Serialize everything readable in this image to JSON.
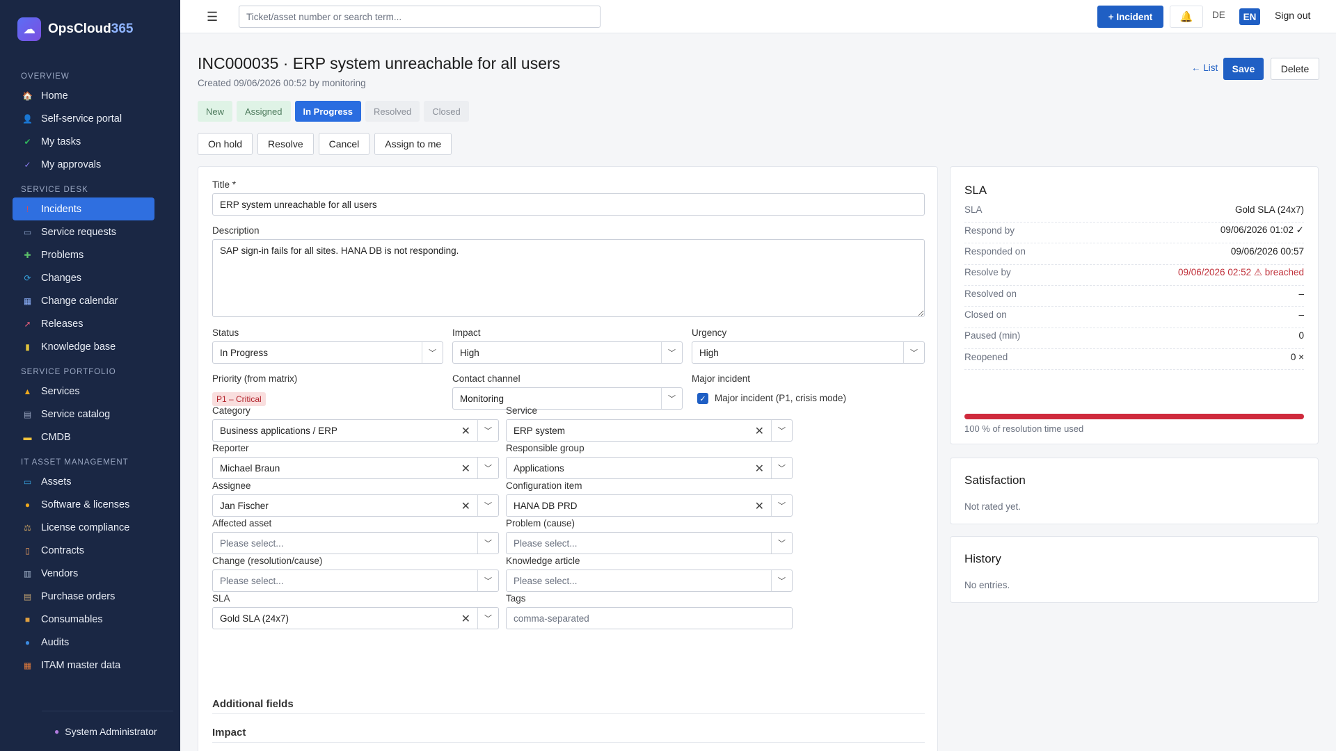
{
  "brand": {
    "name_main": "OpsCloud",
    "name_accent": "365"
  },
  "sidebar": {
    "sections": [
      {
        "title": "OVERVIEW",
        "items": [
          {
            "label": "Home",
            "icon": "home-icon"
          },
          {
            "label": "Self-service portal",
            "icon": "user-icon"
          },
          {
            "label": "My tasks",
            "icon": "check-icon"
          },
          {
            "label": "My approvals",
            "icon": "checkmark-icon"
          }
        ]
      },
      {
        "title": "SERVICE DESK",
        "items": [
          {
            "label": "Incidents",
            "icon": "incident-icon",
            "active": true
          },
          {
            "label": "Service requests",
            "icon": "inbox-icon"
          },
          {
            "label": "Problems",
            "icon": "puzzle-icon"
          },
          {
            "label": "Changes",
            "icon": "refresh-icon"
          },
          {
            "label": "Change calendar",
            "icon": "calendar-icon"
          },
          {
            "label": "Releases",
            "icon": "rocket-icon"
          },
          {
            "label": "Knowledge base",
            "icon": "books-icon"
          }
        ]
      },
      {
        "title": "SERVICE PORTFOLIO",
        "items": [
          {
            "label": "Services",
            "icon": "bell-service-icon"
          },
          {
            "label": "Service catalog",
            "icon": "catalog-icon"
          },
          {
            "label": "CMDB",
            "icon": "folder-icon"
          }
        ]
      },
      {
        "title": "IT ASSET MANAGEMENT",
        "items": [
          {
            "label": "Assets",
            "icon": "monitor-icon"
          },
          {
            "label": "Software & licenses",
            "icon": "disc-icon"
          },
          {
            "label": "License compliance",
            "icon": "scales-icon"
          },
          {
            "label": "Contracts",
            "icon": "document-icon"
          },
          {
            "label": "Vendors",
            "icon": "building-icon"
          },
          {
            "label": "Purchase orders",
            "icon": "cart-icon"
          },
          {
            "label": "Consumables",
            "icon": "box-icon"
          },
          {
            "label": "Audits",
            "icon": "magnifier-icon"
          },
          {
            "label": "ITAM master data",
            "icon": "grid-icon"
          }
        ]
      }
    ],
    "user": "System Administrator"
  },
  "topbar": {
    "search_placeholder": "Ticket/asset number or search term...",
    "new_incident": "+ Incident",
    "lang_de": "DE",
    "lang_en": "EN",
    "sign_out": "Sign out"
  },
  "header": {
    "title": "INC000035 · ERP system unreachable for all users",
    "subtitle": "Created 09/06/2026 00:52 by monitoring",
    "list_link": "← List",
    "save": "Save",
    "delete": "Delete"
  },
  "workflow": {
    "steps": [
      {
        "label": "New",
        "state": "done"
      },
      {
        "label": "Assigned",
        "state": "done"
      },
      {
        "label": "In Progress",
        "state": "current"
      },
      {
        "label": "Resolved",
        "state": "future"
      },
      {
        "label": "Closed",
        "state": "future"
      }
    ],
    "actions": [
      "On hold",
      "Resolve",
      "Cancel",
      "Assign to me"
    ]
  },
  "form": {
    "title_label": "Title *",
    "title_value": "ERP system unreachable for all users",
    "description_label": "Description",
    "description_value": "SAP sign-in fails for all sites. HANA DB is not responding.",
    "status_label": "Status",
    "status_value": "In Progress",
    "impact_label": "Impact",
    "impact_value": "High",
    "urgency_label": "Urgency",
    "urgency_value": "High",
    "priority_label": "Priority (from matrix)",
    "priority_value": "P1 – Critical",
    "channel_label": "Contact channel",
    "channel_value": "Monitoring",
    "major_label": "Major incident",
    "major_check_label": "Major incident (P1, crisis mode)",
    "major_checked": true,
    "category_label": "Category",
    "category_value": "Business applications / ERP",
    "service_label": "Service",
    "service_value": "ERP system",
    "reporter_label": "Reporter",
    "reporter_value": "Michael Braun",
    "group_label": "Responsible group",
    "group_value": "Applications",
    "assignee_label": "Assignee",
    "assignee_value": "Jan Fischer",
    "ci_label": "Configuration item",
    "ci_value": "HANA DB PRD",
    "asset_label": "Affected asset",
    "asset_placeholder": "Please select...",
    "problem_label": "Problem (cause)",
    "problem_placeholder": "Please select...",
    "change_label": "Change (resolution/cause)",
    "change_placeholder": "Please select...",
    "kb_label": "Knowledge article",
    "kb_placeholder": "Please select...",
    "sla_label": "SLA",
    "sla_value": "Gold SLA (24x7)",
    "tags_label": "Tags",
    "tags_placeholder": "comma-separated",
    "additional_heading": "Additional fields",
    "impact_heading": "Impact"
  },
  "sla": {
    "title": "SLA",
    "rows": [
      {
        "k": "SLA",
        "v": "Gold SLA (24x7)"
      },
      {
        "k": "Respond by",
        "v": "09/06/2026 01:02 ✓"
      },
      {
        "k": "Responded on",
        "v": "09/06/2026 00:57"
      },
      {
        "k": "Resolve by",
        "v": "09/06/2026 02:52 ⚠ breached",
        "breach": true
      },
      {
        "k": "Resolved on",
        "v": "–"
      },
      {
        "k": "Closed on",
        "v": "–"
      },
      {
        "k": "Paused (min)",
        "v": "0"
      },
      {
        "k": "Reopened",
        "v": "0 ×"
      }
    ],
    "progress_fraction": 1.0,
    "progress_label": "100 % of resolution time used",
    "bar_color": "#cf2a3c"
  },
  "satisfaction": {
    "title": "Satisfaction",
    "text": "Not rated yet."
  },
  "history": {
    "title": "History",
    "text": "No entries."
  }
}
